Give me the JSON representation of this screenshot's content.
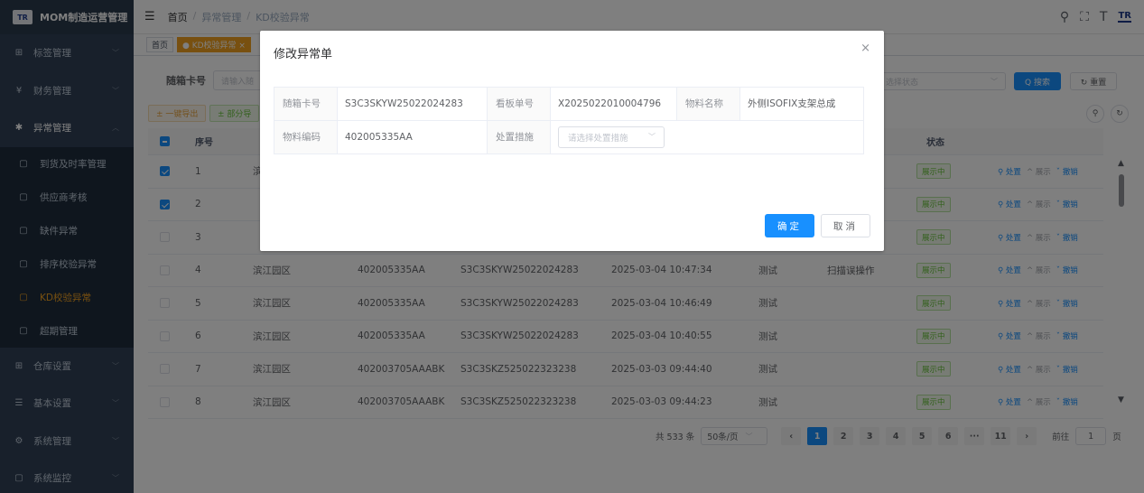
{
  "app": {
    "title": "MOM制造运营管理",
    "logo_text": "TR"
  },
  "sidebar": {
    "items": [
      {
        "label": "标签管理",
        "icon": "grid-icon",
        "glyph": "⊞"
      },
      {
        "label": "财务管理",
        "icon": "yen-icon",
        "glyph": "¥"
      },
      {
        "label": "异常管理",
        "icon": "bug-icon",
        "glyph": "✱"
      }
    ],
    "sub_items": [
      {
        "label": "到货及时率管理",
        "glyph": "▢"
      },
      {
        "label": "供应商考核",
        "glyph": "▢"
      },
      {
        "label": "缺件异常",
        "glyph": "▢"
      },
      {
        "label": "排序校验异常",
        "glyph": "▢"
      },
      {
        "label": "KD校验异常",
        "glyph": "▢"
      },
      {
        "label": "超期管理",
        "glyph": "▢"
      }
    ],
    "bottom_items": [
      {
        "label": "仓库设置",
        "glyph": "⊞"
      },
      {
        "label": "基本设置",
        "glyph": "☰"
      },
      {
        "label": "系统管理",
        "glyph": "⚙"
      },
      {
        "label": "系统监控",
        "glyph": "▢"
      }
    ]
  },
  "breadcrumb": {
    "home": "首页",
    "sep": "/",
    "level1": "异常管理",
    "level2": "KD校验异常"
  },
  "tags": {
    "home": "首页",
    "active": "● KD校验异常 ×"
  },
  "search": {
    "card_label": "随箱卡号",
    "card_placeholder": "请输入随",
    "status_placeholder": "选择状态",
    "search_button": "Q 搜索",
    "reset_button": "↻ 重置"
  },
  "toolbar": {
    "export_button": "± 一键导出",
    "part_button": "± 部分导"
  },
  "table": {
    "headers": {
      "index": "序号",
      "status": "状态"
    },
    "status_value": "展示中",
    "ops": {
      "handle": "⚲ 处置",
      "show": "^ 展示",
      "revoke": "ˇ 撤销"
    },
    "rows": [
      {
        "idx": "1",
        "park": "滨",
        "code": "",
        "card": "",
        "time": "",
        "prod": "",
        "meas": "",
        "checked": true
      },
      {
        "idx": "2",
        "park": "",
        "code": "",
        "card": "",
        "time": "",
        "prod": "",
        "meas": "",
        "checked": true
      },
      {
        "idx": "3",
        "park": "",
        "code": "",
        "card": "",
        "time": "",
        "prod": "",
        "meas": "",
        "checked": false
      },
      {
        "idx": "4",
        "park": "滨江园区",
        "code": "402005335AA",
        "card": "S3C3SKYW25022024283",
        "time": "2025-03-04 10:47:34",
        "prod": "测试",
        "meas": "扫描误操作",
        "checked": false
      },
      {
        "idx": "5",
        "park": "滨江园区",
        "code": "402005335AA",
        "card": "S3C3SKYW25022024283",
        "time": "2025-03-04 10:46:49",
        "prod": "测试",
        "meas": "",
        "checked": false
      },
      {
        "idx": "6",
        "park": "滨江园区",
        "code": "402005335AA",
        "card": "S3C3SKYW25022024283",
        "time": "2025-03-04 10:40:55",
        "prod": "测试",
        "meas": "",
        "checked": false
      },
      {
        "idx": "7",
        "park": "滨江园区",
        "code": "402003705AAABK",
        "card": "S3C3SKZ525022323238",
        "time": "2025-03-03 09:44:40",
        "prod": "测试",
        "meas": "",
        "checked": false
      },
      {
        "idx": "8",
        "park": "滨江园区",
        "code": "402003705AAABK",
        "card": "S3C3SKZ525022323238",
        "time": "2025-03-03 09:44:23",
        "prod": "测试",
        "meas": "",
        "checked": false
      }
    ]
  },
  "pagination": {
    "total": "共 533 条",
    "page_size": "50条/页",
    "pages": [
      "1",
      "2",
      "3",
      "4",
      "5",
      "6",
      "···",
      "11"
    ],
    "current": "1",
    "jump_label": "前往",
    "jump_value": "1",
    "jump_unit": "页"
  },
  "modal": {
    "title": "修改异常单",
    "fields": {
      "card_label": "随箱卡号",
      "card_value": "S3C3SKYW25022024283",
      "kanban_label": "看板单号",
      "kanban_value": "X2025022010004796",
      "mat_name_label": "物料名称",
      "mat_name_value": "外侧ISOFIX支架总成",
      "mat_code_label": "物料编码",
      "mat_code_value": "402005335AA",
      "measure_label": "处置措施",
      "measure_placeholder": "请选择处置措施"
    },
    "confirm": "确定",
    "cancel": "取消"
  }
}
